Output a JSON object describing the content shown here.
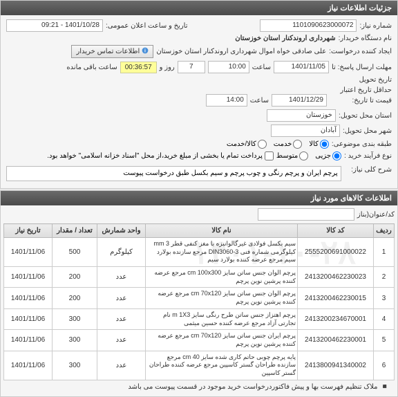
{
  "panel1": {
    "title": "جزئیات اطلاعات نیاز",
    "need_no_label": "شماره نیاز:",
    "need_no": "1101090623000072",
    "announce_label": "تاریخ و ساعت اعلان عمومی:",
    "announce_value": "1401/10/28 - 09:21",
    "buyer_org_label": "نام دستگاه خریدار:",
    "buyer_org": "شهرداری اروندکنار استان خوزستان",
    "creator_label": "ایجاد کننده درخواست:",
    "creator": "علی صادقی خواه اموال شهرداری اروندکنار استان خوزستان",
    "contact_btn": "اطلاعات تماس خریدار",
    "deadline_label": "مهلت ارسال پاسخ: تا",
    "deadline_date": "1401/11/05",
    "time_label": "ساعت",
    "deadline_time": "10:00",
    "days": "7",
    "days_label": "روز و",
    "timer": "00:36:57",
    "remaining_label": "ساعت باقی مانده",
    "delivery_label": "تاریخ تحویل",
    "credit_label": "حداقل تاریخ اعتبار",
    "credit_sub": "قیمت تا تاریخ:",
    "credit_date": "1401/12/29",
    "credit_time": "14:00",
    "province_label": "استان محل تحویل:",
    "province": "خوزستان",
    "city_label": "شهر محل تحویل:",
    "city": "آبادان",
    "category_label": "طبقه بندی موضوعی:",
    "opt_goods": "کالا",
    "opt_service": "خدمت",
    "opt_goods_service": "کالا/خدمت",
    "process_label": "نوع فرآیند خرید :",
    "opt_minor": "جزیی",
    "opt_medium": "متوسط",
    "process_note": "پرداخت تمام یا بخشی از مبلغ خرید،از محل \"اسناد خزانه اسلامی\" خواهد بود.",
    "desc_label": "شرح کلی نیاز:",
    "desc": "پرچم ایران و پرچم رنگی و چوب پرچم و سیم بکسل طبق درخواست پیوست"
  },
  "panel2": {
    "title": "اطلاعات کالاهای مورد نیاز",
    "filter_label": "کد/عنوان(بناز",
    "cols": {
      "row": "ردیف",
      "code": "کد کالا",
      "name": "نام کالا",
      "unit": "واحد شمارش",
      "qty": "تعداد / مقدار",
      "date": "تاریخ نیاز"
    },
    "rows": [
      {
        "n": "1",
        "code": "2555200691000022",
        "name": "سیم بکسل فولادی غیرگالوانیزه با مغز کنفی قطر mm 3 کیلوگرمی شماره فنی DIN3060-3 مرجع سازنده بولارد سیم مرجع عرضه کننده بولارد سیم",
        "unit": "کیلوگرم",
        "qty": "500",
        "date": "1401/11/06"
      },
      {
        "n": "2",
        "code": "2413200462230023",
        "name": "پرچم الوان جنس ساتن سایز cm 100x300 مرجع عرضه کننده پرشین نوین پرچم",
        "unit": "عدد",
        "qty": "200",
        "date": "1401/11/06"
      },
      {
        "n": "3",
        "code": "2413200462230015",
        "name": "پرچم الوان جنس ساتن سایز cm 70x120 مرجع عرضه کننده پرشین نوین پرچم",
        "unit": "عدد",
        "qty": "200",
        "date": "1401/11/06"
      },
      {
        "n": "4",
        "code": "2413200234670001",
        "name": "پرچم اهتزاز جنس ساتن طرح رنگی سایز m 1X3 نام تجارتی آزاد مرجع عرضه کننده حسین میثمی",
        "unit": "عدد",
        "qty": "300",
        "date": "1401/11/06"
      },
      {
        "n": "5",
        "code": "2413200462230001",
        "name": "پرچم ایران جنس ساتن سایز cm 70x120 مرجع عرضه کننده پرشین نوین پرچم",
        "unit": "عدد",
        "qty": "300",
        "date": "1401/11/06"
      },
      {
        "n": "6",
        "code": "2413800941340002",
        "name": "پایه پرچم چوبی حاتم کاری شده سایز cm 40 مرجع سازنده طراحان گستر کاسپین مرجع عرضه کننده طراحان گستر کاسپین",
        "unit": "عدد",
        "qty": "300",
        "date": "1401/11/06"
      }
    ],
    "footer_note": "ملاک تنظیم فهرست بها و پیش فاکتوردرخواست خرید موجود در قسمت پیوست می باشد"
  }
}
